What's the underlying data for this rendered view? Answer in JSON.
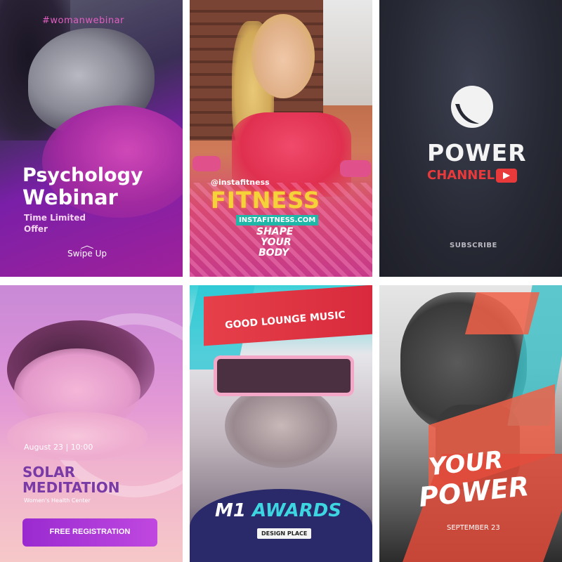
{
  "card1": {
    "hashtag": "#womanwebinar",
    "title_line1": "Psychology",
    "title_line2": "Webinar",
    "offer_line1": "Time Limited",
    "offer_line2": "Offer",
    "swipe_label": "Swipe Up",
    "accent": "#a0219a"
  },
  "card2": {
    "handle": "@instafitness",
    "title": "FITNESS",
    "url": "INSTAFITNESS.COM",
    "slogan_line1": "SHAPE",
    "slogan_line2": "YOUR",
    "slogan_line3": "BODY",
    "accent": "#f6d23a"
  },
  "card3": {
    "logo_icon": "drop-logo-icon",
    "title_line1": "POWER",
    "title_line2": "CHANNEL",
    "youtube_icon": "youtube-play-icon",
    "subscribe_label": "SUBSCRIBE",
    "accent": "#e83a3a"
  },
  "card4": {
    "date_text": "August 23 | 10:00",
    "title_line1": "SOLAR",
    "title_line2": "MEDITATION",
    "subtitle": "Women's Health Center",
    "button_label": "FREE REGISTRATION",
    "accent": "#7a3aa6"
  },
  "card5": {
    "headline": "GOOD LOUNGE MUSIC",
    "title_prefix": "M1 ",
    "title_main": "AWARDS",
    "dj_label": "DESIGN PLACE",
    "accent": "#3dd6e0"
  },
  "card6": {
    "title_line1": "YOUR",
    "title_line2": "POWER",
    "date_text": "SEPTEMBER 23",
    "accent": "#f06048"
  }
}
